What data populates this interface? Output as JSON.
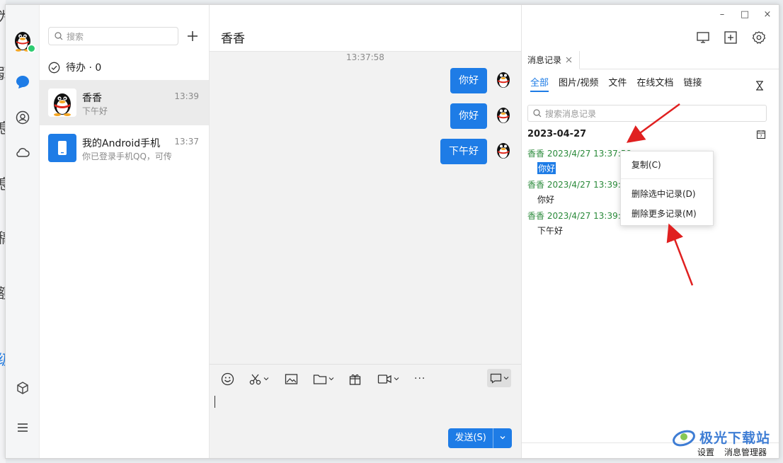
{
  "background_fragments": [
    "为",
    "弱",
    "息",
    "息",
    "稿",
    "额",
    "级"
  ],
  "window_controls": {
    "minimize": "–",
    "maximize": "□",
    "close": "×"
  },
  "contacts": {
    "search_placeholder": "搜索",
    "todo_label": "待办 · 0",
    "conversations": [
      {
        "name": "香香",
        "time": "13:39",
        "preview": "下午好"
      },
      {
        "name": "我的Android手机",
        "time": "13:37",
        "preview": "你已登录手机QQ，可传"
      }
    ]
  },
  "chat": {
    "title": "香香",
    "timestamp": "13:37:58",
    "messages": [
      "你好",
      "你好",
      "下午好"
    ],
    "send_label": "发送(S)",
    "more_label": "···"
  },
  "history": {
    "tab_label": "消息记录",
    "filters": [
      "全部",
      "图片/视频",
      "文件",
      "在线文档",
      "链接"
    ],
    "search_placeholder": "搜索消息记录",
    "date": "2023-04-27",
    "records": [
      {
        "meta": "香香 2023/4/27 13:37:58",
        "text": "你好"
      },
      {
        "meta": "香香 2023/4/27 13:39:2",
        "text": "你好"
      },
      {
        "meta": "香香 2023/4/27 13:39:3",
        "text": "下午好"
      }
    ],
    "footer_settings": "设置",
    "footer_manager": "消息管理器"
  },
  "context_menu": {
    "copy": "复制(C)",
    "delete_selected": "删除选中记录(D)",
    "delete_more": "删除更多记录(M)"
  },
  "watermark": "极光下载站",
  "colors": {
    "accent": "#1e7ce6",
    "meta_green": "#2a8a3a",
    "arrow_red": "#e02020"
  }
}
